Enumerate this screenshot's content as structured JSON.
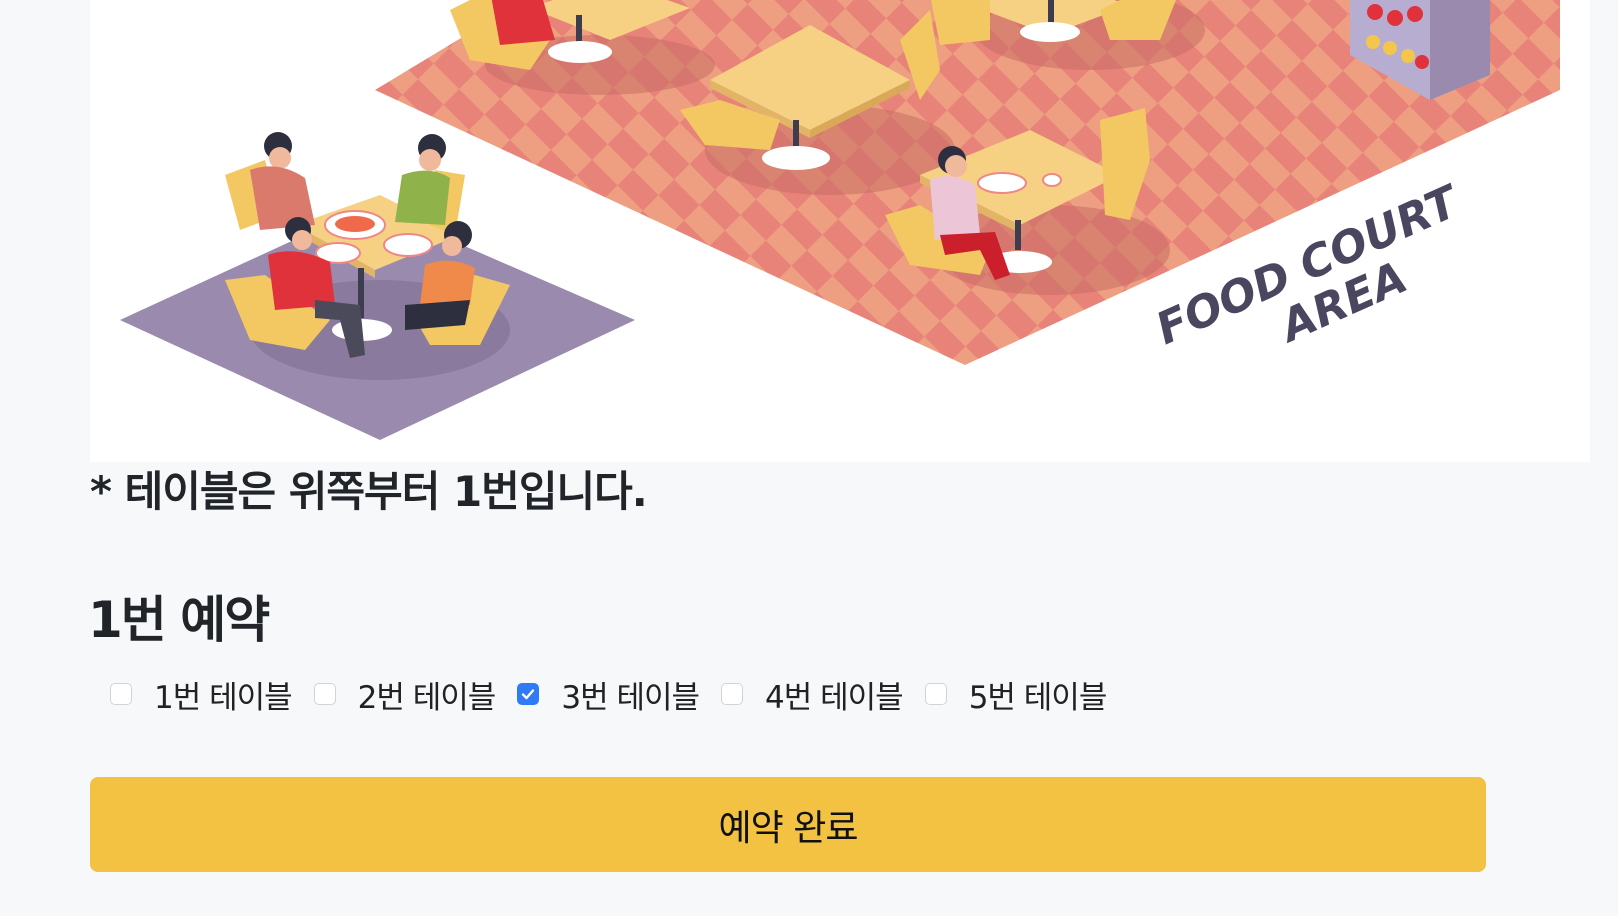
{
  "illustration": {
    "sign_line1": "FOOD COURT",
    "sign_line2": "AREA"
  },
  "note": "* 테이블은 위쪽부터 1번입니다.",
  "reservation": {
    "title": "1번 예약",
    "options": [
      {
        "label": "1번 테이블",
        "checked": false
      },
      {
        "label": "2번 테이블",
        "checked": false
      },
      {
        "label": "3번 테이블",
        "checked": true
      },
      {
        "label": "4번 테이블",
        "checked": false
      },
      {
        "label": "5번 테이블",
        "checked": false
      }
    ],
    "submit_label": "예약 완료"
  },
  "colors": {
    "accent": "#f3c242",
    "checkbox_checked": "#2f7bf5",
    "floor_a": "#e8837a",
    "floor_b": "#ee9f82",
    "purple_floor": "#9a8aad"
  }
}
